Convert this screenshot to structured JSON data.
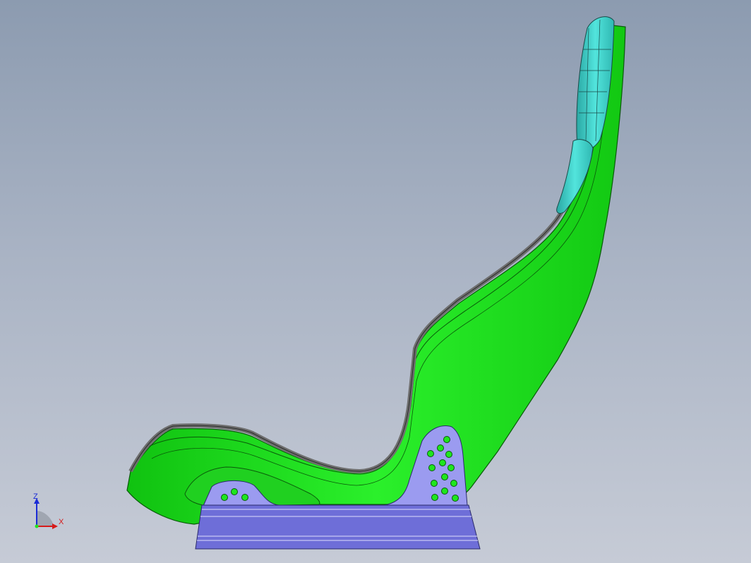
{
  "viewport": {
    "background_top": "#8c9bb0",
    "background_bottom": "#c6cbd6"
  },
  "model": {
    "parts": [
      {
        "name": "seat-shell",
        "color": "#1ee61e"
      },
      {
        "name": "shell-rim",
        "color": "#6e6e6e"
      },
      {
        "name": "headrest-padding",
        "color": "#3fd6d0"
      },
      {
        "name": "side-mount-bracket",
        "color": "#9b9bf0"
      },
      {
        "name": "mount-base-rail",
        "color": "#6e6ed8"
      },
      {
        "name": "mounting-holes",
        "color": "#1ee61e"
      }
    ]
  },
  "triad": {
    "z_label": "Z",
    "x_label": "X",
    "z_color": "#1a2bd6",
    "x_color": "#d61a1a"
  }
}
